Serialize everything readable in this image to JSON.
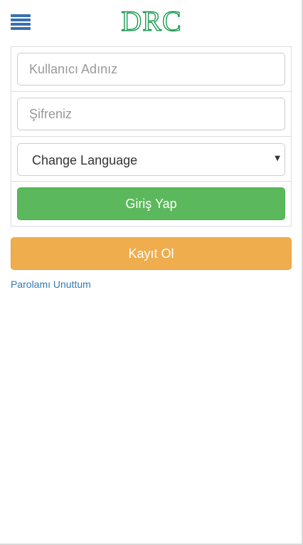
{
  "header": {
    "menu_icon": "hamburger-menu-icon",
    "logo_text": "DRC"
  },
  "login_form": {
    "username": {
      "placeholder": "Kullanıcı Adınız",
      "value": ""
    },
    "password": {
      "placeholder": "Şifreniz",
      "value": ""
    },
    "language": {
      "selected": "Change Language",
      "caret_icon": "chevron-down-icon"
    },
    "login_label": "Giriş Yap"
  },
  "register_label": "Kayıt Ol",
  "forgot_password_label": "Parolamı Unuttum",
  "colors": {
    "menu_icon": "#3a6fb0",
    "logo": "#1a9a4f",
    "login_button": "#5cb85c",
    "register_button": "#f0ad4e",
    "link": "#337ab7"
  }
}
